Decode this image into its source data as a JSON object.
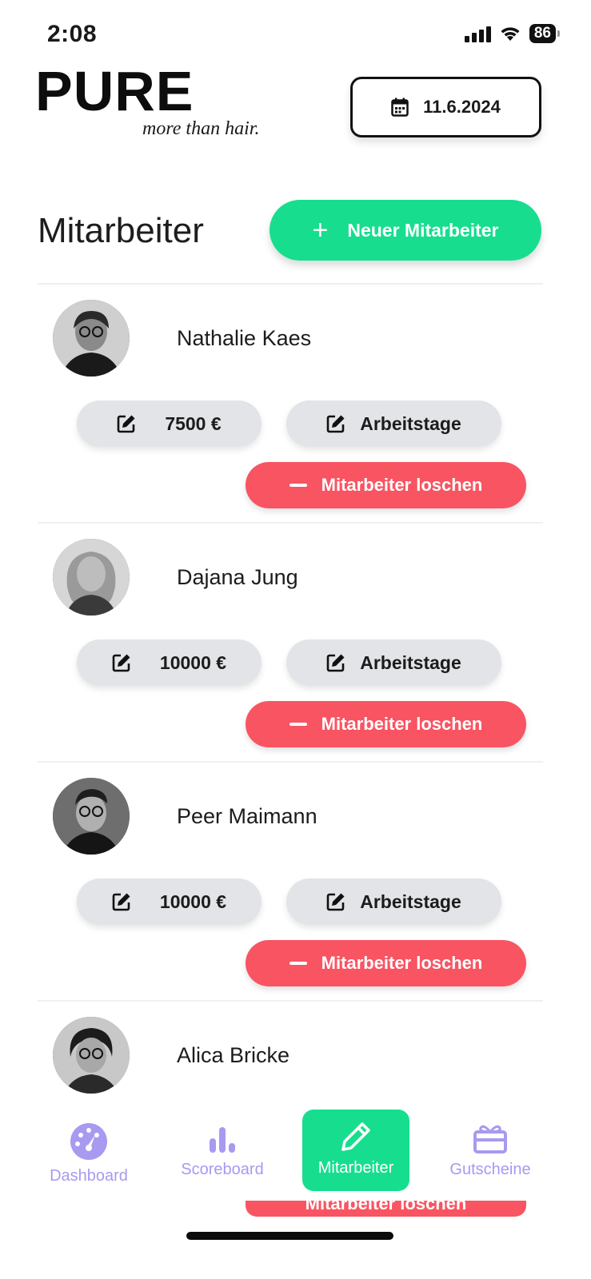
{
  "status_bar": {
    "time": "2:08",
    "battery": "86"
  },
  "header": {
    "logo_main": "PURE",
    "logo_sub": "more than hair.",
    "date": "11.6.2024"
  },
  "section": {
    "title": "Mitarbeiter",
    "new_button": "Neuer Mitarbeiter"
  },
  "employees": [
    {
      "name": "Nathalie Kaes",
      "salary": "7500 €",
      "days_label": "Arbeitstage",
      "delete_label": "Mitarbeiter loschen"
    },
    {
      "name": "Dajana Jung",
      "salary": "10000 €",
      "days_label": "Arbeitstage",
      "delete_label": "Mitarbeiter loschen"
    },
    {
      "name": "Peer Maimann",
      "salary": "10000 €",
      "days_label": "Arbeitstage",
      "delete_label": "Mitarbeiter loschen"
    },
    {
      "name": "Alica Bricke",
      "delete_label": "Mitarbeiter loschen"
    }
  ],
  "nav": [
    {
      "label": "Dashboard",
      "icon": "dashboard-icon"
    },
    {
      "label": "Scoreboard",
      "icon": "bar-chart-icon"
    },
    {
      "label": "Mitarbeiter",
      "icon": "pencil-icon",
      "active": true
    },
    {
      "label": "Gutscheine",
      "icon": "gift-icon"
    }
  ],
  "colors": {
    "accent_green": "#16de8e",
    "delete_red": "#f95462",
    "nav_purple": "#a79af0",
    "pill_gray": "#e2e4e7"
  }
}
